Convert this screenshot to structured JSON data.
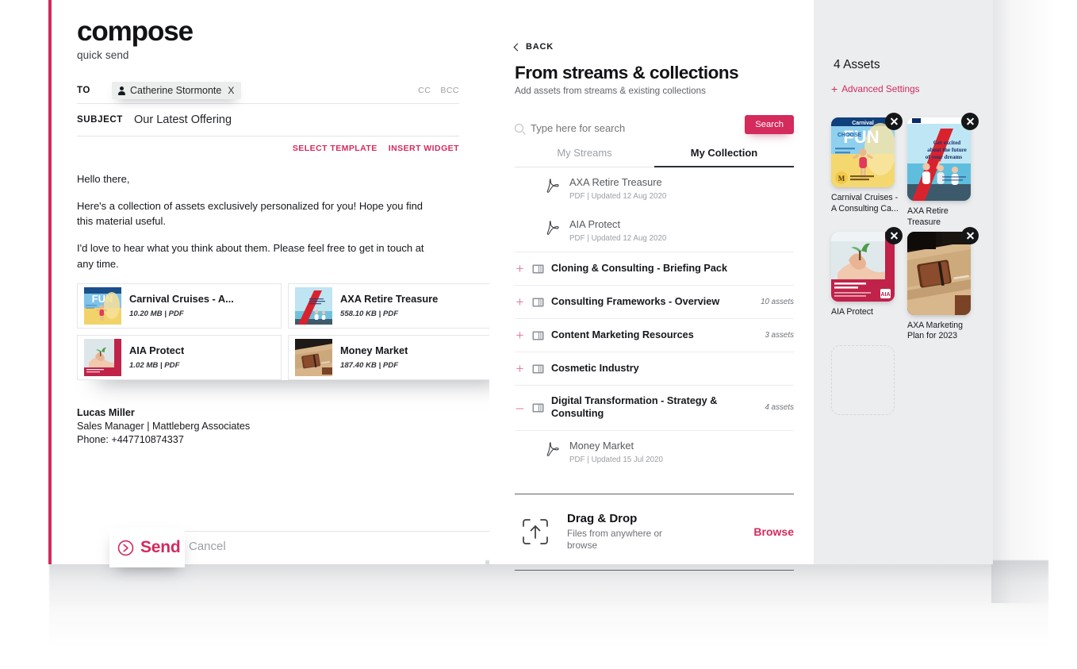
{
  "compose": {
    "title": "compose",
    "subtitle": "quick send",
    "to_label": "TO",
    "recipient": "Catherine Stormonte",
    "chip_remove": "X",
    "cc_label": "CC",
    "bcc_label": "BCC",
    "subject_label": "SUBJECT",
    "subject_value": "Our Latest Offering",
    "select_template": "SELECT TEMPLATE",
    "insert_widget": "INSERT WIDGET",
    "body_paragraphs": [
      "Hello there,",
      "Here's a collection of assets exclusively personalized for you! Hope you find this material useful.",
      "I'd love to hear what you think about them. Please feel free to get in touch at any time."
    ],
    "email_assets": [
      {
        "name": "Carnival Cruises - A...",
        "meta": "10.20 MB | PDF",
        "art": "carnival"
      },
      {
        "name": "AXA Retire Treasure",
        "meta": "558.10 KB | PDF",
        "art": "axa"
      },
      {
        "name": "AIA Protect",
        "meta": "1.02 MB | PDF",
        "art": "aia"
      },
      {
        "name": "Money Market",
        "meta": "187.40 KB | PDF",
        "art": "money"
      }
    ],
    "signature": {
      "name": "Lucas Miller",
      "role": "Sales Manager | Mattleberg Associates",
      "phone": "Phone: +447710874337"
    },
    "send_label": "Send",
    "cancel_label": "Cancel"
  },
  "middle": {
    "back_label": "BACK",
    "title": "From streams & collections",
    "subtitle": "Add assets from streams & existing collections",
    "search_placeholder": "Type here for search",
    "search_value": "",
    "search_button": "Search",
    "tabs": [
      {
        "label": "My Streams",
        "active": false
      },
      {
        "label": "My Collection",
        "active": true
      }
    ],
    "top_assets": [
      {
        "name": "AXA Retire Treasure",
        "meta": "PDF | Updated 12 Aug 2020"
      },
      {
        "name": "AIA Protect",
        "meta": "PDF | Updated 12 Aug 2020"
      }
    ],
    "collections": [
      {
        "toggle": "+",
        "name": "Cloning & Consulting - Briefing Pack",
        "count": ""
      },
      {
        "toggle": "+",
        "name": "Consulting Frameworks - Overview",
        "count": "10 assets"
      },
      {
        "toggle": "+",
        "name": "Content Marketing Resources",
        "count": "3 assets"
      },
      {
        "toggle": "+",
        "name": "Cosmetic Industry",
        "count": ""
      },
      {
        "toggle": "–",
        "name": "Digital Transformation - Strategy & Consulting",
        "count": "4 assets"
      }
    ],
    "expanded_assets": [
      {
        "name": "Money Market",
        "meta": "PDF | Updated 15 Jul 2020"
      }
    ],
    "dragdrop": {
      "title": "Drag & Drop",
      "subtitle": "Files from anywhere or browse",
      "browse_label": "Browse"
    }
  },
  "right": {
    "assets_count_label": "4 Assets",
    "advanced_settings": "Advanced Settings",
    "advanced_plus": "+",
    "assets": [
      {
        "label": "Carnival Cruises - A Consulting Ca...",
        "art": "carnival",
        "tall": false
      },
      {
        "label": "AXA Retire Treasure",
        "art": "axa",
        "tall": true
      },
      {
        "label": "AIA Protect",
        "art": "aia",
        "tall": false
      },
      {
        "label": "AXA Marketing Plan for 2023",
        "art": "money",
        "tall": true
      }
    ],
    "placeholder_present": true
  },
  "colors": {
    "accent": "#d32a5c",
    "accent_button": "#d42a5c",
    "panel_gray": "#ecedef",
    "text_dark": "#15181c",
    "text_muted": "#9aa0a6"
  }
}
